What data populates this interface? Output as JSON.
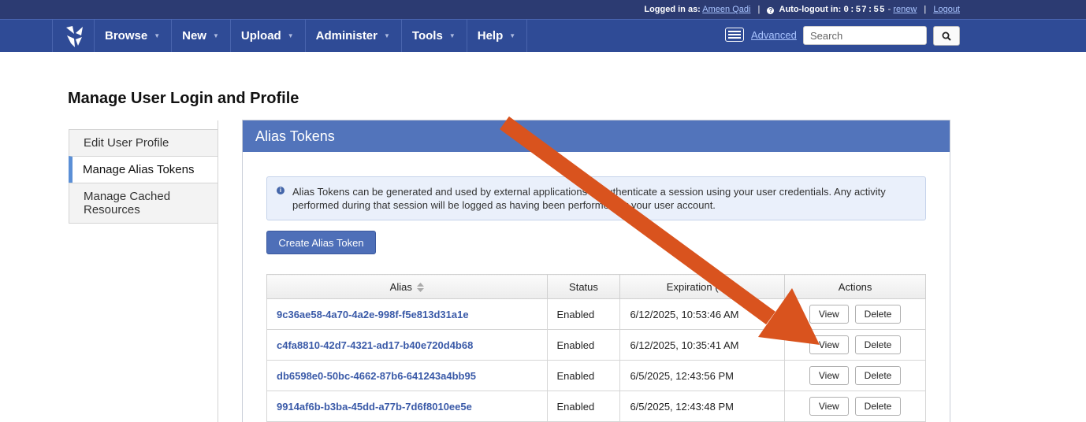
{
  "topbar": {
    "logged_in_label": "Logged in as:",
    "user": "Ameen Qadi",
    "autologout_label": "Auto-logout in:",
    "timer": "0:57:55",
    "renew": "renew",
    "logout": "Logout"
  },
  "nav": {
    "items": [
      {
        "label": "Browse"
      },
      {
        "label": "New"
      },
      {
        "label": "Upload"
      },
      {
        "label": "Administer"
      },
      {
        "label": "Tools"
      },
      {
        "label": "Help"
      }
    ],
    "advanced": "Advanced",
    "search_placeholder": "Search"
  },
  "page": {
    "title": "Manage User Login and Profile"
  },
  "sidebar": {
    "items": [
      {
        "label": "Edit User Profile"
      },
      {
        "label": "Manage Alias Tokens"
      },
      {
        "label": "Manage Cached Resources"
      }
    ]
  },
  "panel": {
    "title": "Alias Tokens",
    "info": "Alias Tokens can be generated and used by external applications to authenticate a session using your user credentials. Any activity performed during that session will be logged as having been performed by your user account.",
    "create_button": "Create Alias Token"
  },
  "table": {
    "headers": {
      "alias": "Alias",
      "status": "Status",
      "expiration": "Expiration (est.)",
      "actions": "Actions"
    },
    "rows": [
      {
        "alias": "9c36ae58-4a70-4a2e-998f-f5e813d31a1e",
        "status": "Enabled",
        "expiration": "6/12/2025, 10:53:46 AM",
        "view": "View",
        "delete": "Delete"
      },
      {
        "alias": "c4fa8810-42d7-4321-ad17-b40e720d4b68",
        "status": "Enabled",
        "expiration": "6/12/2025, 10:35:41 AM",
        "view": "View",
        "delete": "Delete"
      },
      {
        "alias": "db6598e0-50bc-4662-87b6-641243a4bb95",
        "status": "Enabled",
        "expiration": "6/5/2025, 12:43:56 PM",
        "view": "View",
        "delete": "Delete"
      },
      {
        "alias": "9914af6b-b3ba-45dd-a77b-7d6f8010ee5e",
        "status": "Enabled",
        "expiration": "6/5/2025, 12:43:48 PM",
        "view": "View",
        "delete": "Delete"
      }
    ]
  },
  "colors": {
    "topbar": "#2c3b72",
    "navbar": "#2f4b96",
    "panel_header": "#5274bb",
    "annotation_arrow": "#d9531e"
  },
  "icons": [
    "logo-icon",
    "clock-icon",
    "advanced-search-icon",
    "search-icon",
    "info-icon",
    "sort-icon",
    "annotation-arrow-icon"
  ]
}
